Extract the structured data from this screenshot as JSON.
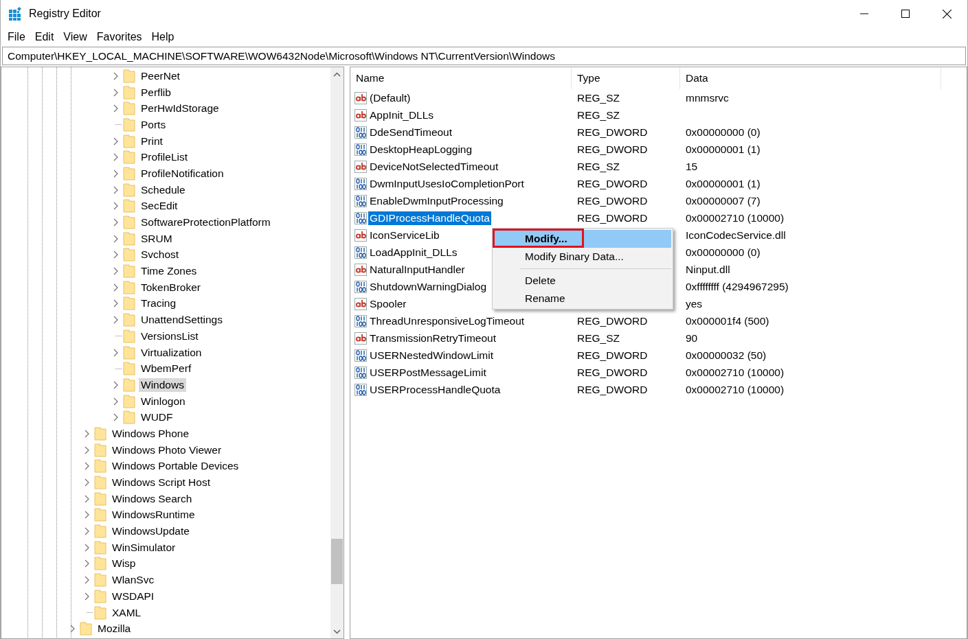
{
  "window": {
    "title": "Registry Editor"
  },
  "menu_bar": [
    "File",
    "Edit",
    "View",
    "Favorites",
    "Help"
  ],
  "address": "Computer\\HKEY_LOCAL_MACHINE\\SOFTWARE\\WOW6432Node\\Microsoft\\Windows NT\\CurrentVersion\\Windows",
  "tree": [
    {
      "children": [
        {
          "children": [
            {
              "children": [
                {
                  "label": "PeerNet",
                  "has_children": true,
                  "selected": false
                },
                {
                  "label": "Perflib",
                  "has_children": true,
                  "selected": false
                },
                {
                  "label": "PerHwIdStorage",
                  "has_children": true,
                  "selected": false
                },
                {
                  "label": "Ports",
                  "has_children": false,
                  "selected": false
                },
                {
                  "label": "Print",
                  "has_children": true,
                  "selected": false
                },
                {
                  "label": "ProfileList",
                  "has_children": true,
                  "selected": false
                },
                {
                  "label": "ProfileNotification",
                  "has_children": true,
                  "selected": false
                },
                {
                  "label": "Schedule",
                  "has_children": true,
                  "selected": false
                },
                {
                  "label": "SecEdit",
                  "has_children": true,
                  "selected": false
                },
                {
                  "label": "SoftwareProtectionPlatform",
                  "has_children": true,
                  "selected": false
                },
                {
                  "label": "SRUM",
                  "has_children": true,
                  "selected": false
                },
                {
                  "label": "Svchost",
                  "has_children": true,
                  "selected": false
                },
                {
                  "label": "Time Zones",
                  "has_children": true,
                  "selected": false
                },
                {
                  "label": "TokenBroker",
                  "has_children": true,
                  "selected": false
                },
                {
                  "label": "Tracing",
                  "has_children": true,
                  "selected": false
                },
                {
                  "label": "UnattendSettings",
                  "has_children": true,
                  "selected": false
                },
                {
                  "label": "VersionsList",
                  "has_children": false,
                  "selected": false
                },
                {
                  "label": "Virtualization",
                  "has_children": true,
                  "selected": false
                },
                {
                  "label": "WbemPerf",
                  "has_children": false,
                  "selected": false
                },
                {
                  "label": "Windows",
                  "has_children": true,
                  "selected": true
                },
                {
                  "label": "Winlogon",
                  "has_children": true,
                  "selected": false
                },
                {
                  "label": "WUDF",
                  "has_children": true,
                  "selected": false
                }
              ]
            }
          ]
        },
        {
          "label": "Windows Phone",
          "has_children": true,
          "selected": false
        },
        {
          "label": "Windows Photo Viewer",
          "has_children": true,
          "selected": false
        },
        {
          "label": "Windows Portable Devices",
          "has_children": true,
          "selected": false
        },
        {
          "label": "Windows Script Host",
          "has_children": true,
          "selected": false
        },
        {
          "label": "Windows Search",
          "has_children": true,
          "selected": false
        },
        {
          "label": "WindowsRuntime",
          "has_children": true,
          "selected": false
        },
        {
          "label": "WindowsUpdate",
          "has_children": true,
          "selected": false
        },
        {
          "label": "WinSimulator",
          "has_children": true,
          "selected": false
        },
        {
          "label": "Wisp",
          "has_children": true,
          "selected": false
        },
        {
          "label": "WlanSvc",
          "has_children": true,
          "selected": false
        },
        {
          "label": "WSDAPI",
          "has_children": true,
          "selected": false
        },
        {
          "label": "XAML",
          "has_children": false,
          "selected": false
        }
      ]
    },
    {
      "label": "Mozilla",
      "has_children": true,
      "selected": false
    }
  ],
  "values": {
    "columns": [
      "Name",
      "Type",
      "Data"
    ],
    "rows": [
      {
        "kind": "string",
        "name": "(Default)",
        "type": "REG_SZ",
        "data": "mnmsrvc",
        "selected": false
      },
      {
        "kind": "string",
        "name": "AppInit_DLLs",
        "type": "REG_SZ",
        "selected": false
      },
      {
        "kind": "dword",
        "name": "DdeSendTimeout",
        "type": "REG_DWORD",
        "data": "0x00000000 (0)",
        "selected": false
      },
      {
        "kind": "dword",
        "name": "DesktopHeapLogging",
        "type": "REG_DWORD",
        "data": "0x00000001 (1)",
        "selected": false
      },
      {
        "kind": "string",
        "name": "DeviceNotSelectedTimeout",
        "type": "REG_SZ",
        "data": "15",
        "selected": false
      },
      {
        "kind": "dword",
        "name": "DwmInputUsesIoCompletionPort",
        "type": "REG_DWORD",
        "data": "0x00000001 (1)",
        "selected": false
      },
      {
        "kind": "dword",
        "name": "EnableDwmInputProcessing",
        "type": "REG_DWORD",
        "data": "0x00000007 (7)",
        "selected": false
      },
      {
        "kind": "dword",
        "name": "GDIProcessHandleQuota",
        "type": "REG_DWORD",
        "data": "0x00002710 (10000)",
        "selected": true
      },
      {
        "kind": "string",
        "name": "IconServiceLib",
        "data": "IconCodecService.dll",
        "selected": false
      },
      {
        "kind": "dword",
        "name": "LoadAppInit_DLLs",
        "data": "0x00000000 (0)",
        "selected": false
      },
      {
        "kind": "string",
        "name": "NaturalInputHandler",
        "data": "Ninput.dll",
        "selected": false
      },
      {
        "kind": "dword",
        "name": "ShutdownWarningDialog",
        "data": "0xffffffff (4294967295)",
        "selected": false
      },
      {
        "kind": "string",
        "name": "Spooler",
        "data": "yes",
        "selected": false
      },
      {
        "kind": "dword",
        "name": "ThreadUnresponsiveLogTimeout",
        "type": "REG_DWORD",
        "data": "0x000001f4 (500)",
        "selected": false
      },
      {
        "kind": "string",
        "name": "TransmissionRetryTimeout",
        "type": "REG_SZ",
        "data": "90",
        "selected": false
      },
      {
        "kind": "dword",
        "name": "USERNestedWindowLimit",
        "type": "REG_DWORD",
        "data": "0x00000032 (50)",
        "selected": false
      },
      {
        "kind": "dword",
        "name": "USERPostMessageLimit",
        "type": "REG_DWORD",
        "data": "0x00002710 (10000)",
        "selected": false
      },
      {
        "kind": "dword",
        "name": "USERProcessHandleQuota",
        "type": "REG_DWORD",
        "data": "0x00002710 (10000)",
        "selected": false
      }
    ]
  },
  "context_menu": [
    {
      "kind": "item",
      "label": "Modify...",
      "default": true,
      "selected": true,
      "outlined": true
    },
    {
      "kind": "item",
      "label": "Modify Binary Data...",
      "default": false,
      "selected": false,
      "outlined": false
    },
    {
      "kind": "separator"
    },
    {
      "kind": "item",
      "label": "Delete",
      "default": false,
      "selected": false,
      "outlined": false
    },
    {
      "kind": "item",
      "label": "Rename",
      "default": false,
      "selected": false,
      "outlined": false
    }
  ]
}
